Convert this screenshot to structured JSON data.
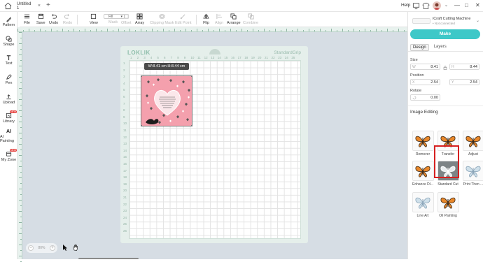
{
  "titlebar": {
    "tab_title": "Untitled 1",
    "tab_close": "×",
    "new_tab": "+",
    "help": "Help",
    "win_minimize": "—",
    "win_maximize": "□",
    "win_close": "✕"
  },
  "toolbar": {
    "file": "File",
    "save": "Save",
    "undo": "Undo",
    "redo": "Redo",
    "view": "View",
    "fill_value": "Fill",
    "mask": "Mask",
    "offset": "Offset",
    "array": "Array",
    "clipping_mask": "Clipping Mask",
    "edit_point": "Edit Point",
    "flip": "Flip",
    "align": "Align",
    "arrange": "Arrange",
    "combine": "Combine"
  },
  "leftbar": {
    "items": [
      {
        "label": "Pattern",
        "icon": "pattern-icon"
      },
      {
        "label": "Shape",
        "icon": "shape-icon"
      },
      {
        "label": "Text",
        "icon": "text-icon"
      },
      {
        "label": "Pen",
        "icon": "pen-icon"
      },
      {
        "label": "Upload",
        "icon": "upload-icon"
      },
      {
        "label": "Library",
        "icon": "library-icon",
        "badge": "NEW"
      },
      {
        "label": "AI Painting",
        "icon": "ai-painting-icon"
      },
      {
        "label": "My Zone",
        "icon": "my-zone-icon",
        "badge": "NEW"
      }
    ]
  },
  "canvas": {
    "mat_brand": "LOKLIK",
    "mat_type": "StandardGrip",
    "size_tooltip": "W:8.41 cm  H:8.44 cm",
    "zoom_value": "80%",
    "zoom_out": "−",
    "zoom_in": "+",
    "top_numbers": [
      "1",
      "2",
      "3",
      "4",
      "5",
      "6",
      "7",
      "8",
      "9",
      "10",
      "11",
      "12",
      "13",
      "14",
      "15",
      "16",
      "17",
      "18",
      "19",
      "20",
      "21",
      "22",
      "23",
      "24",
      "25",
      "26",
      "27",
      "28",
      "29",
      "30"
    ],
    "left_numbers": [
      "1",
      "2",
      "3",
      "4",
      "5",
      "6",
      "7",
      "8",
      "9",
      "10",
      "11",
      "12",
      "13",
      "14",
      "15",
      "16",
      "17",
      "18",
      "19",
      "20",
      "21",
      "22",
      "23",
      "24",
      "25",
      "26",
      "27",
      "28",
      "29",
      "30"
    ]
  },
  "rightpanel": {
    "machine_name": "iCraft Cutting Machine",
    "machine_status": "• Not connected",
    "make": "Make",
    "tab_design": "Design",
    "tab_layers": "Layers",
    "size_label": "Size",
    "w_key": "W",
    "w_val": "8.41",
    "h_key": "H",
    "h_val": "8.44",
    "position_label": "Position",
    "x_key": "X",
    "x_val": "2.54",
    "y_key": "Y",
    "y_val": "2.54",
    "rotate_label": "Rotate",
    "r_val": "0.00",
    "image_editing": "Image Editing",
    "tools": [
      "Remover",
      "Transfer",
      "Adjust",
      "Enhance Dl...",
      "Standard Cut",
      "Print Then ...",
      "Line Art",
      "Oil Painting"
    ]
  },
  "colors": {
    "accent": "#3ec8c8",
    "mat": "#e5efeb",
    "design_pink": "#f4a0ad",
    "selection_red": "#d62020"
  }
}
